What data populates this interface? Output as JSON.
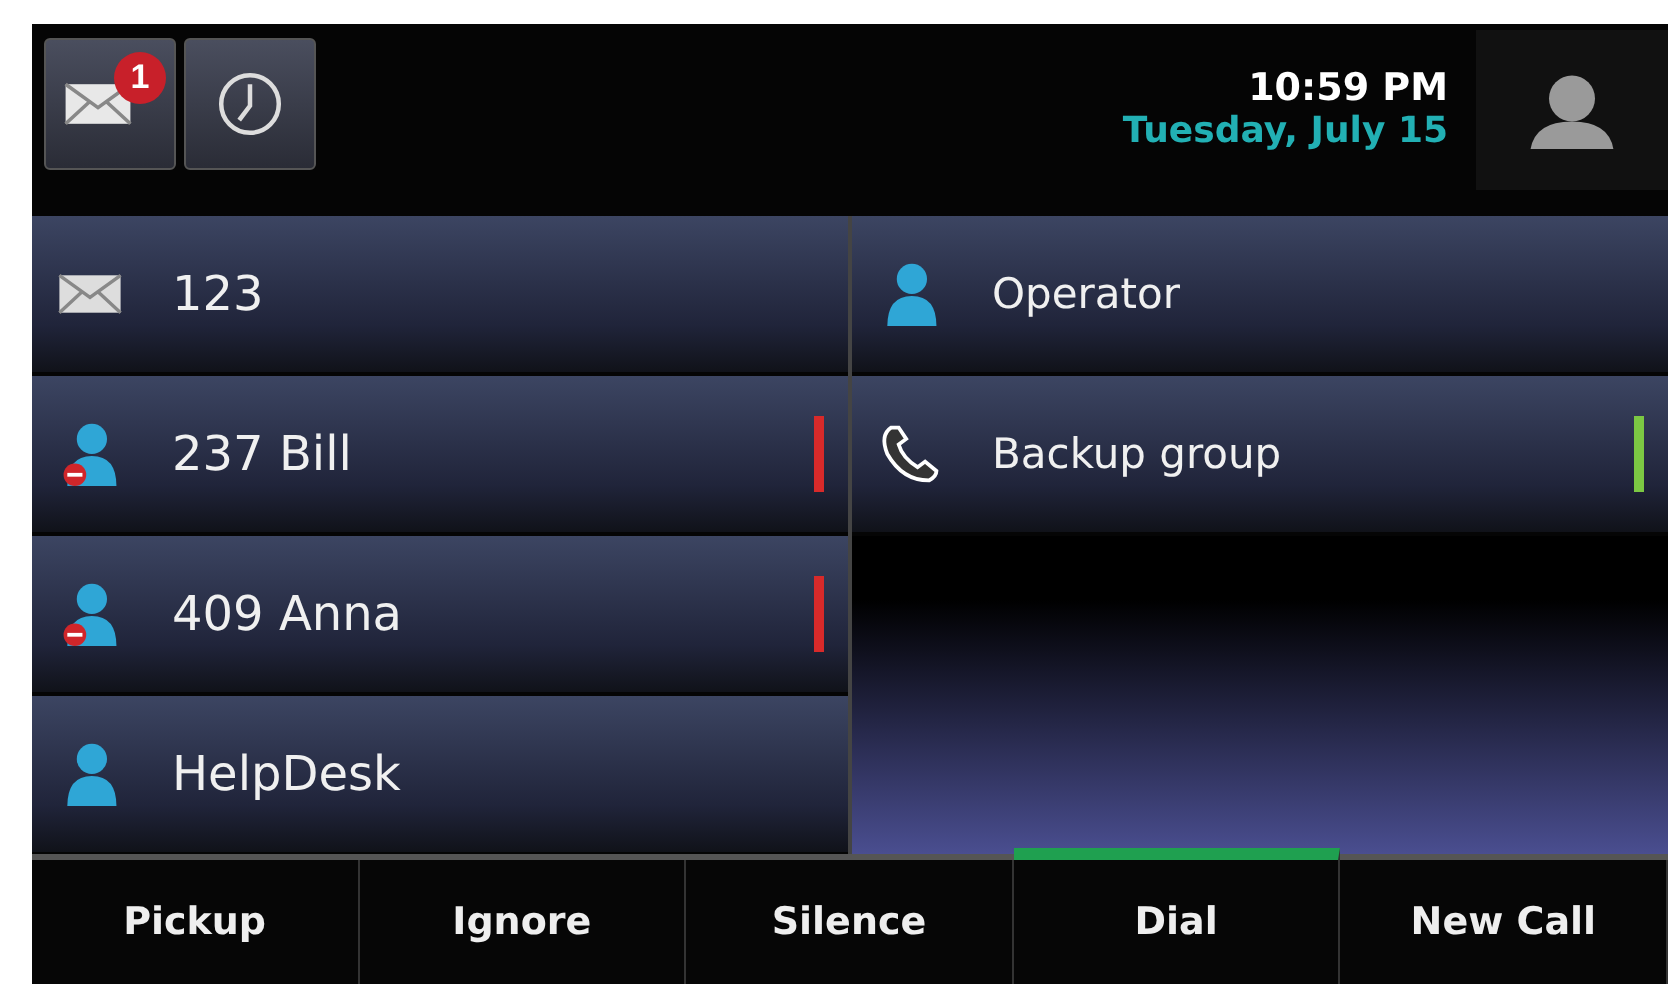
{
  "header": {
    "message_badge": "1",
    "time": "10:59 PM",
    "date": "Tuesday, July 15"
  },
  "left_lines": [
    {
      "kind": "voicemail",
      "label": "123"
    },
    {
      "kind": "blocked",
      "label": "237 Bill",
      "color": "#d82a2a"
    },
    {
      "kind": "blocked",
      "label": "409 Anna",
      "color": "#d82a2a"
    },
    {
      "kind": "contact",
      "label": "HelpDesk"
    }
  ],
  "right_lines": [
    {
      "kind": "contact",
      "label": "Operator"
    },
    {
      "kind": "phone",
      "label": "Backup group",
      "color": "#7cc843"
    }
  ],
  "softkeys": [
    {
      "label": "Pickup",
      "selected": false
    },
    {
      "label": "Ignore",
      "selected": false
    },
    {
      "label": "Silence",
      "selected": false
    },
    {
      "label": "Dial",
      "selected": true
    },
    {
      "label": "New Call",
      "selected": false
    }
  ]
}
